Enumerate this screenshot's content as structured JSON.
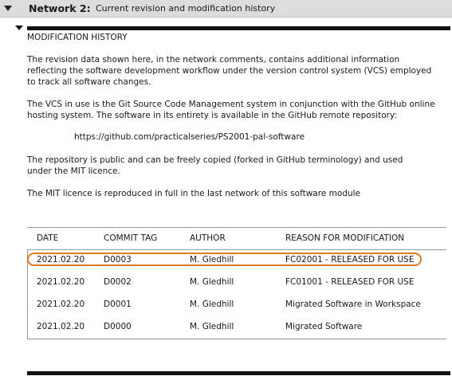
{
  "network": {
    "label": "Network 2:",
    "comment": "Current revision and modification history"
  },
  "comment_block": {
    "heading": "MODIFICATION HISTORY",
    "para1_line1": "The revision data shown here, in the network comments, contains additional information",
    "para1_line2": "reflecting the software development workflow under the version control system (VCS) employed",
    "para1_line3": "to track all software changes.",
    "para2_line1": "The VCS in use is the Git Source Code Management system in conjunction with the GitHub online",
    "para2_line2": "hosting system. The software in its entirety is available in the GitHub remote repository:",
    "url": "https://github.com/practicalseries/PS2001-pal-software",
    "para3_line1": "The repository is public and can be freely copied (forked in GitHub terminology) and used",
    "para3_line2": "under the MIT licence.",
    "para4": "The MIT licence is reproduced in full in the last network of this software module"
  },
  "history_table": {
    "headers": {
      "date": "DATE",
      "commit": "COMMIT TAG",
      "author": "AUTHOR",
      "reason": "REASON FOR MODIFICATION"
    },
    "rows": [
      {
        "date": "2021.02.20",
        "commit": "D0003",
        "author": "M. Gledhill",
        "reason": "FC02001 - RELEASED FOR USE"
      },
      {
        "date": "2021.02.20",
        "commit": "D0002",
        "author": "M. Gledhill",
        "reason": "FC01001 - RELEASED FOR USE"
      },
      {
        "date": "2021.02.20",
        "commit": "D0001",
        "author": "M. Gledhill",
        "reason": "Migrated Software in Workspace"
      },
      {
        "date": "2021.02.20",
        "commit": "D0000",
        "author": "M. Gledhill",
        "reason": "Migrated Software"
      }
    ]
  },
  "colors": {
    "header_bg": "#dcdcdc",
    "highlight": "#e07a22",
    "rule": "#111111"
  }
}
